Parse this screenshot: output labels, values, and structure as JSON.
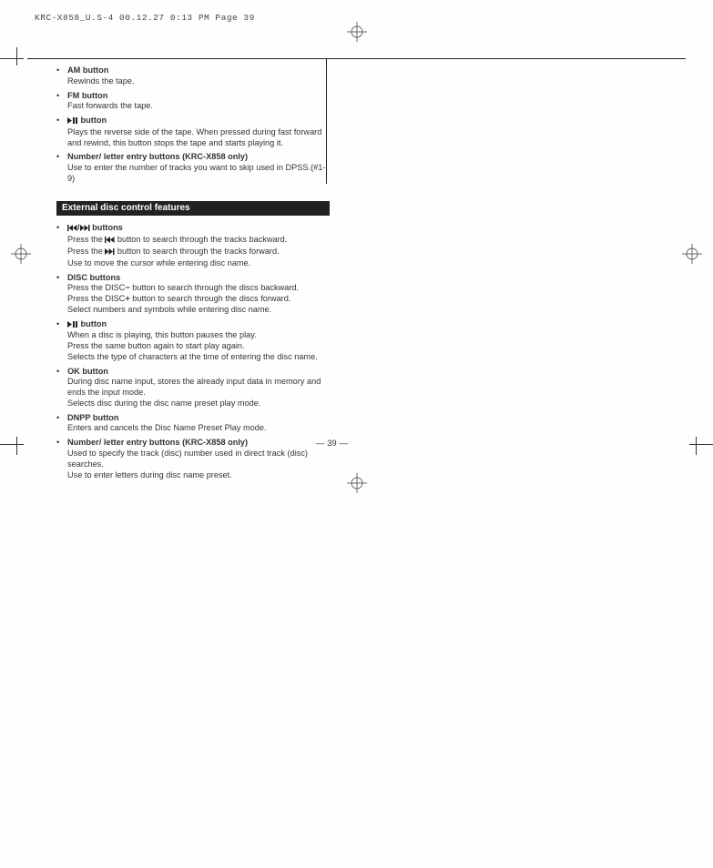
{
  "header": "KRC-X858_U.S-4  00.12.27 0:13 PM  Page 39",
  "page_number": "39",
  "section1": {
    "items": [
      {
        "title_pre": "",
        "title": "AM button",
        "desc": "Rewinds the tape."
      },
      {
        "title_pre": "",
        "title": "FM button",
        "desc": "Fast forwards the tape."
      },
      {
        "title_icon": "playpause",
        "title": " button",
        "desc": "Plays the reverse side of the tape. When pressed during fast forward and rewind, this button stops the tape and starts playing it."
      },
      {
        "title_pre": "",
        "title": "Number/ letter entry buttons (KRC-X858 only)",
        "desc": "Use to enter the number of tracks you want to skip used in DPSS.(#1-9)"
      }
    ]
  },
  "section2": {
    "heading": "External disc control features",
    "items": [
      {
        "title_icon": "rewff",
        "title": " buttons",
        "lines": [
          {
            "pre": "Press the ",
            "icon": "rew",
            "post": " button to search through the tracks backward."
          },
          {
            "pre": "Press the ",
            "icon": "ff",
            "post": " button to search through the tracks forward."
          },
          {
            "plain": "Use to move the cursor while entering disc name."
          }
        ]
      },
      {
        "title": "DISC buttons",
        "lines": [
          {
            "plain_pre": "Press the DISC",
            "sym": "−",
            "plain_post": " button to search through the discs backward."
          },
          {
            "plain_pre": "Press the DISC",
            "sym": "+",
            "plain_post": " button to search through the discs forward."
          },
          {
            "plain": "Select numbers and symbols while entering disc name."
          }
        ]
      },
      {
        "title_icon": "playpause",
        "title": " button",
        "lines": [
          {
            "plain": "When a disc is playing, this button pauses the play."
          },
          {
            "plain": "Press the same button again to start play again."
          },
          {
            "plain": "Selects the type of characters at the time of entering the disc name."
          }
        ]
      },
      {
        "title": "OK button",
        "lines": [
          {
            "plain": "During disc name input, stores the already input data in memory and ends the input mode."
          },
          {
            "plain": "Selects disc during the disc name preset play mode."
          }
        ]
      },
      {
        "title": "DNPP button",
        "lines": [
          {
            "plain": "Enters and cancels the Disc Name Preset Play mode."
          }
        ]
      },
      {
        "title": "Number/ letter entry buttons (KRC-X858 only)",
        "lines": [
          {
            "plain": "Used to specify the track (disc) number used in direct track (disc) searches."
          },
          {
            "plain": "Use to enter letters during disc name preset."
          }
        ]
      }
    ]
  }
}
